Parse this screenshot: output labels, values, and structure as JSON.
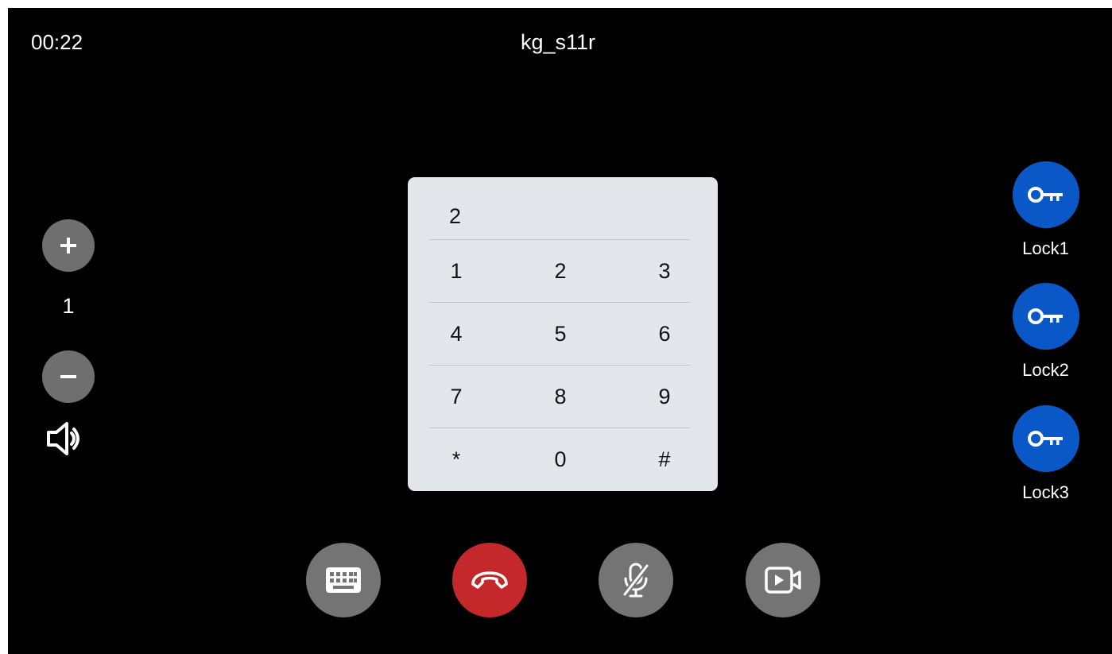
{
  "header": {
    "call_duration": "00:22",
    "caller_name": "kg_s11r"
  },
  "volume": {
    "level": "1",
    "increase_icon": "plus-icon",
    "decrease_icon": "minus-icon",
    "speaker_icon": "speaker-icon"
  },
  "dialpad": {
    "entered_digits": "2",
    "rows": [
      [
        "1",
        "2",
        "3"
      ],
      [
        "4",
        "5",
        "6"
      ],
      [
        "7",
        "8",
        "9"
      ],
      [
        "*",
        "0",
        "#"
      ]
    ]
  },
  "locks": [
    {
      "label": "Lock1",
      "icon": "key-icon"
    },
    {
      "label": "Lock2",
      "icon": "key-icon"
    },
    {
      "label": "Lock3",
      "icon": "key-icon"
    }
  ],
  "controls": {
    "keyboard_icon": "keyboard-icon",
    "hangup_icon": "hang-up-icon",
    "mute_icon": "mic-off-icon",
    "video_icon": "video-icon"
  },
  "colors": {
    "background": "#000000",
    "dialpad_bg": "#e3e7ec",
    "lock_blue": "#0a58c8",
    "hangup_red": "#c4282a",
    "control_gray": "#747474",
    "volume_gray": "#6f6f6f"
  }
}
